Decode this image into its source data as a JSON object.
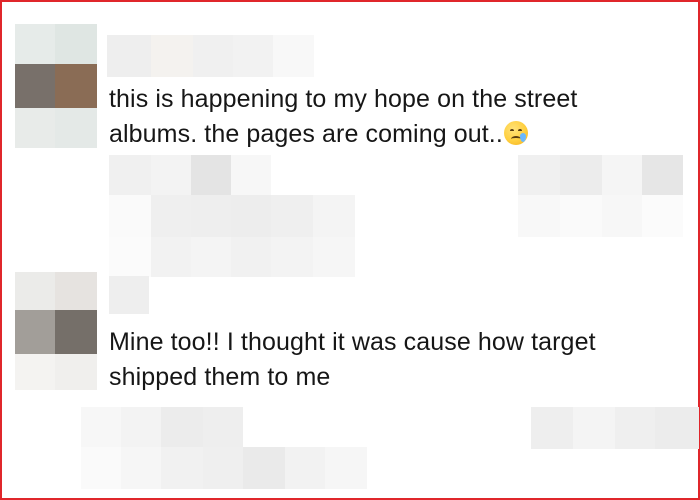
{
  "comments": [
    {
      "text": "this is happening to my hope on the street albums. the pages are coming out..",
      "emoji": "crying-face-with-tear"
    },
    {
      "text": "Mine too!! I thought it was cause how target shipped them to me"
    }
  ],
  "colors": {
    "border": "#e0262b",
    "text": "#161616",
    "tear": "#6bb8ff"
  }
}
